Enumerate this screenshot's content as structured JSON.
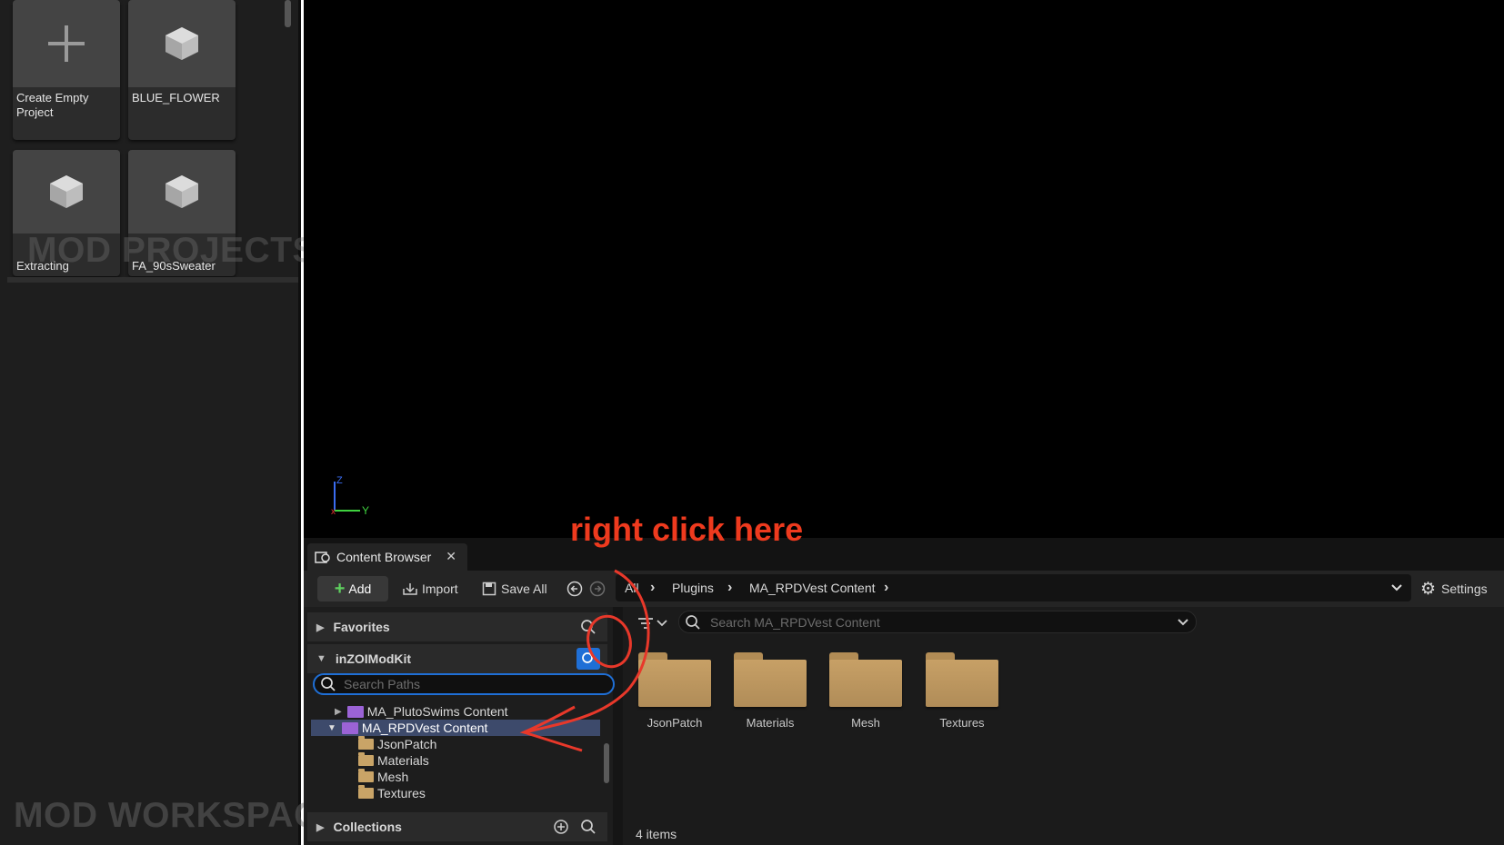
{
  "projects": {
    "tiles": [
      {
        "label": "Create Empty Project",
        "icon": "plus-icon"
      },
      {
        "label": "BLUE_FLOWER",
        "icon": "cube-icon"
      },
      {
        "label": "Extracting",
        "icon": "cube-icon"
      },
      {
        "label": "FA_90sSweater",
        "icon": "cube-icon"
      }
    ],
    "watermark": "MOD PROJECTS"
  },
  "workspace": {
    "watermark": "MOD WORKSPAC"
  },
  "content_browser": {
    "tab_label": "Content Browser",
    "toolbar": {
      "add_label": "Add",
      "import_label": "Import",
      "save_all_label": "Save All",
      "settings_label": "Settings"
    },
    "breadcrumb": [
      "All",
      "Plugins",
      "MA_RPDVest Content"
    ],
    "sources": {
      "favorites_label": "Favorites",
      "root_label": "inZOIModKit",
      "search_placeholder": "Search Paths",
      "tree": [
        {
          "label": "MA_PlutoSwims Content",
          "type": "plugin",
          "expanded": false
        },
        {
          "label": "MA_RPDVest Content",
          "type": "plugin",
          "expanded": true,
          "selected": true
        },
        {
          "label": "JsonPatch",
          "type": "folder"
        },
        {
          "label": "Materials",
          "type": "folder"
        },
        {
          "label": "Mesh",
          "type": "folder"
        },
        {
          "label": "Textures",
          "type": "folder"
        }
      ],
      "collections_label": "Collections"
    },
    "asset_search_placeholder": "Search MA_RPDVest Content",
    "folders": [
      "JsonPatch",
      "Materials",
      "Mesh",
      "Textures"
    ],
    "item_count": "4 items"
  },
  "annotation": {
    "text": "right click here",
    "color": "#ee3a1e"
  },
  "axis": {
    "z": "Z",
    "y": "Y"
  },
  "colors": {
    "accent_blue": "#1f6fd6",
    "folder_tan": "#c9a467",
    "plugin_purple": "#9b63d6"
  }
}
